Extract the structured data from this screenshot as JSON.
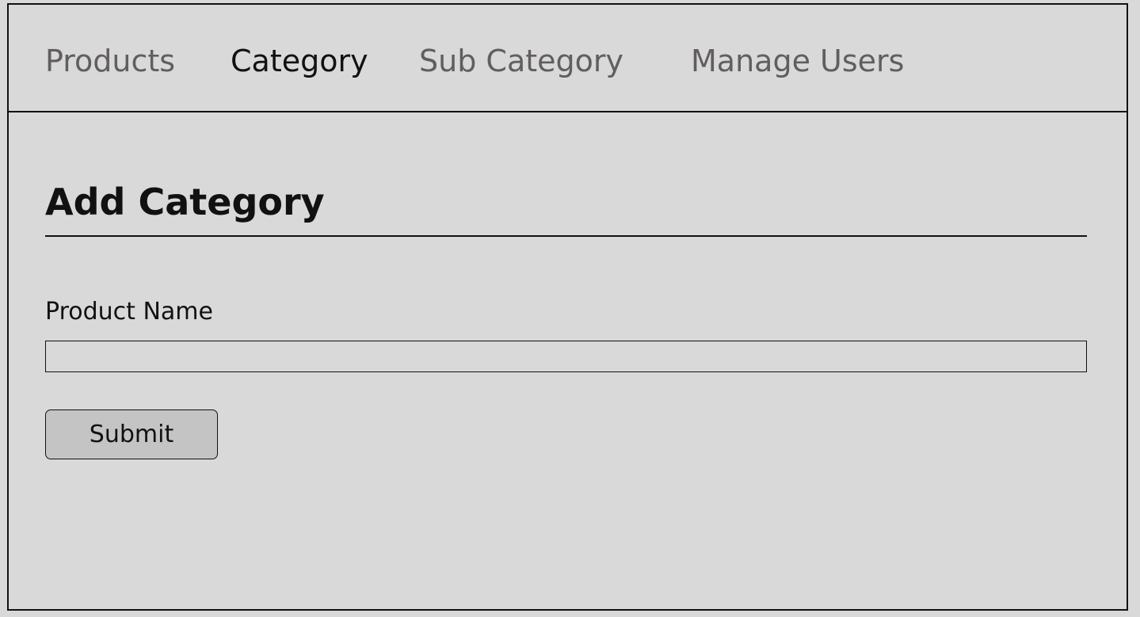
{
  "nav": {
    "items": [
      {
        "label": "Products",
        "active": false
      },
      {
        "label": "Category",
        "active": true
      },
      {
        "label": "Sub Category",
        "active": false
      },
      {
        "label": "Manage Users",
        "active": false
      }
    ]
  },
  "page": {
    "title": "Add Category"
  },
  "form": {
    "field_label": "Product Name",
    "field_value": "",
    "field_placeholder": "",
    "submit_label": "Submit"
  },
  "colors": {
    "background": "#d9d9d9",
    "border": "#111111",
    "nav_inactive_text": "#625e5e",
    "nav_active_text": "#111111",
    "button_background": "#c4c4c4"
  }
}
